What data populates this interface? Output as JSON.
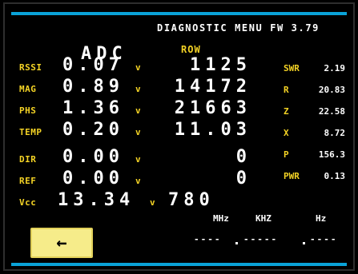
{
  "screen": {
    "title": "DIAGNOSTIC MENU FW 3.79"
  },
  "columns": {
    "adc_header": "ADC",
    "raw_header": "ROW"
  },
  "rows": [
    {
      "label": "RSSI",
      "adc": "0.07",
      "unit": "v",
      "raw": "1125"
    },
    {
      "label": "MAG",
      "adc": "0.89",
      "unit": "v",
      "raw": "14172"
    },
    {
      "label": "PHS",
      "adc": "1.36",
      "unit": "v",
      "raw": "21663"
    },
    {
      "label": "TEMP",
      "adc": "0.20",
      "unit": "v",
      "raw": "11.03"
    },
    {
      "label": "DIR",
      "adc": "0.00",
      "unit": "v",
      "raw": "0"
    },
    {
      "label": "REF",
      "adc": "0.00",
      "unit": "v",
      "raw": "0"
    },
    {
      "label": "Vcc",
      "adc": "13.34",
      "unit": "v",
      "raw": "780"
    }
  ],
  "readings": [
    {
      "label": "SWR",
      "value": "2.19"
    },
    {
      "label": "R",
      "value": "20.83"
    },
    {
      "label": "Z",
      "value": "22.58"
    },
    {
      "label": "X",
      "value": "8.72"
    },
    {
      "label": "P",
      "value": "156.3"
    },
    {
      "label": "PWR",
      "value": "0.13"
    }
  ],
  "frequency": {
    "mhz_label": "MHz",
    "khz_label": "KHZ",
    "hz_label": "Hz",
    "mhz_value": "----",
    "khz_value": "-----",
    "hz_value": "----"
  },
  "back_button": {
    "symbol": "←"
  },
  "colors": {
    "accent_bar": "#0aa3d8",
    "label_yellow": "#f4d325",
    "button_fill": "#f6ec8a"
  }
}
